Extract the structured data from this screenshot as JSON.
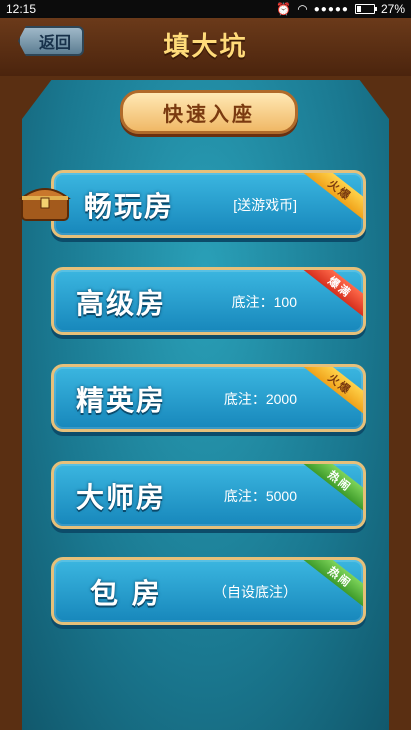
{
  "status": {
    "time": "12:15",
    "battery": "27%"
  },
  "header": {
    "back_label": "返回",
    "title": "填大坑"
  },
  "quick": {
    "label": "快速入座"
  },
  "rooms": [
    {
      "name": "畅玩房",
      "sub": "[送游戏币]",
      "ribbon": "火爆"
    },
    {
      "name": "高级房",
      "sub": "底注：100",
      "ribbon": "爆满"
    },
    {
      "name": "精英房",
      "sub": "底注：2000",
      "ribbon": "火爆"
    },
    {
      "name": "大师房",
      "sub": "底注：5000",
      "ribbon": "热闹"
    },
    {
      "name": "包 房",
      "sub": "（自设底注）",
      "ribbon": "热闹"
    }
  ]
}
